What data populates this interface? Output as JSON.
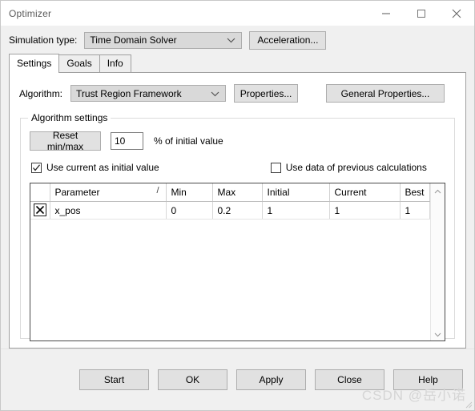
{
  "window": {
    "title": "Optimizer",
    "controls": {
      "minimize": "minimize-icon",
      "maximize": "maximize-icon",
      "close": "close-icon"
    }
  },
  "simulation": {
    "label": "Simulation type:",
    "selected": "Time Domain Solver",
    "options": [
      "Time Domain Solver"
    ],
    "acceleration_button": "Acceleration..."
  },
  "tabs": [
    {
      "label": "Settings",
      "active": true
    },
    {
      "label": "Goals",
      "active": false
    },
    {
      "label": "Info",
      "active": false
    }
  ],
  "settings": {
    "algorithm": {
      "label": "Algorithm:",
      "selected": "Trust Region Framework",
      "options": [
        "Trust Region Framework"
      ],
      "properties_button": "Properties...",
      "general_properties_button": "General Properties..."
    },
    "group": {
      "title": "Algorithm settings",
      "reset_button": "Reset min/max",
      "percent_value": "10",
      "percent_label": "% of initial value",
      "checkbox_current": {
        "label": "Use current as initial value",
        "checked": true
      },
      "checkbox_previous": {
        "label": "Use data of previous calculations",
        "checked": false
      }
    },
    "table": {
      "columns": [
        "",
        "Parameter",
        "Min",
        "Max",
        "Initial",
        "Current",
        "Best"
      ],
      "sort_indicator": "/",
      "rows": [
        {
          "enabled_mark": "x-mark",
          "parameter": "x_pos",
          "min": "0",
          "max": "0.2",
          "initial": "1",
          "current": "1",
          "best": "1"
        }
      ]
    }
  },
  "footer": {
    "buttons": [
      {
        "label": "Start"
      },
      {
        "label": "OK"
      },
      {
        "label": "Apply"
      },
      {
        "label": "Close"
      },
      {
        "label": "Help"
      }
    ],
    "watermark": "CSDN @岳小诺"
  },
  "colors": {
    "window_bg": "#f0f0f0",
    "panel_bg": "#ffffff",
    "button_bg": "#e1e1e1",
    "border": "#adadad",
    "dim_text": "#9a9a9a",
    "watermark": "#d5d5d5"
  }
}
